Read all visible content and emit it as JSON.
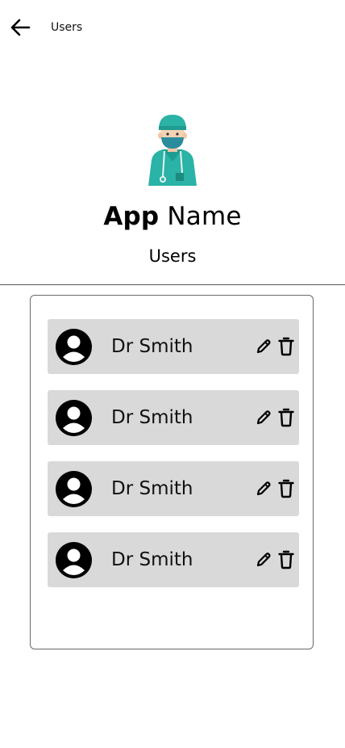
{
  "header": {
    "title": "Users",
    "back_icon": "arrow-left-icon"
  },
  "brand": {
    "name_bold": "App",
    "name_regular": "Name",
    "logo_icon": "doctor-avatar-icon"
  },
  "page": {
    "subtitle": "Users"
  },
  "users": [
    {
      "name": "Dr Smith"
    },
    {
      "name": "Dr Smith"
    },
    {
      "name": "Dr Smith"
    },
    {
      "name": "Dr Smith"
    }
  ],
  "colors": {
    "row_bg": "#d9d9d9",
    "accent_teal": "#2ab3a6"
  }
}
